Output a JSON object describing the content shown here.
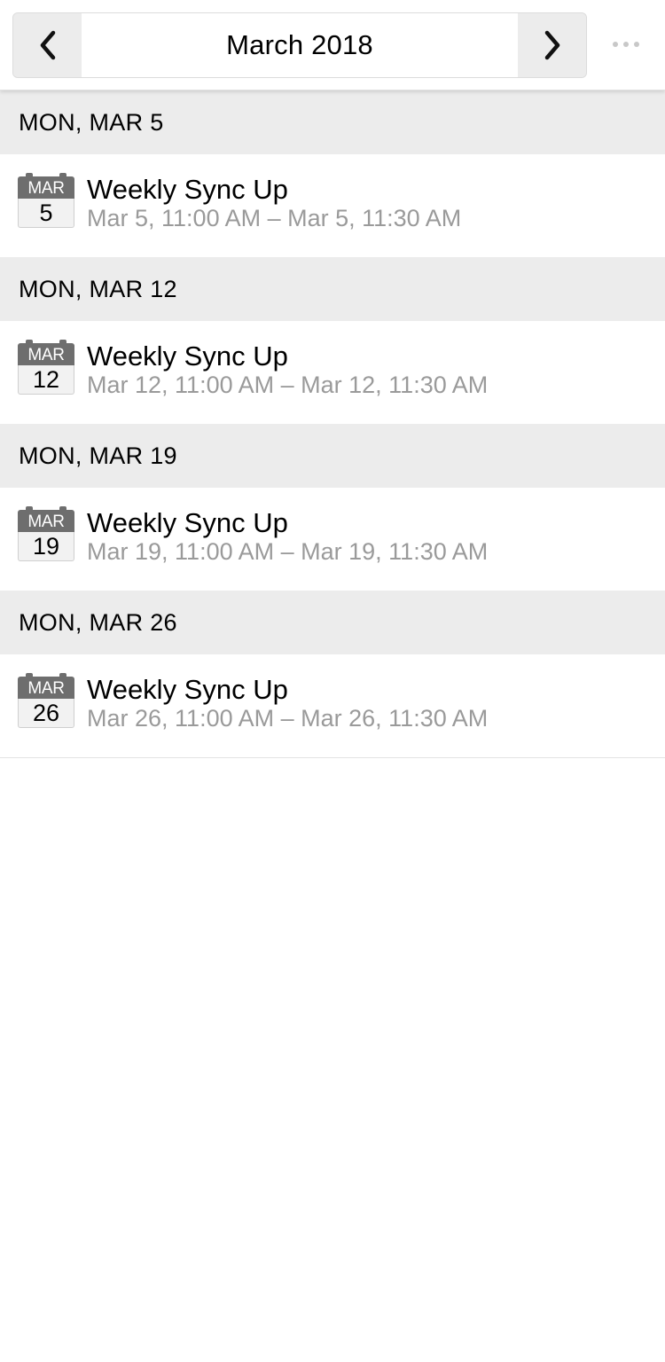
{
  "header": {
    "month_label": "March 2018",
    "prev_icon": "chevron-left-icon",
    "next_icon": "chevron-right-icon",
    "more_icon": "more-horizontal-icon"
  },
  "colors": {
    "day_header_bg": "#ececec",
    "icon_gray": "#6e6e6e",
    "secondary_text": "#9a9a9a"
  },
  "days": [
    {
      "header": "MON, MAR 5",
      "event": {
        "badge_month": "MAR",
        "badge_day": "5",
        "title": "Weekly Sync Up",
        "time": "Mar 5, 11:00 AM – Mar 5, 11:30 AM"
      }
    },
    {
      "header": "MON, MAR 12",
      "event": {
        "badge_month": "MAR",
        "badge_day": "12",
        "title": "Weekly Sync Up",
        "time": "Mar 12, 11:00 AM – Mar 12, 11:30 AM"
      }
    },
    {
      "header": "MON, MAR 19",
      "event": {
        "badge_month": "MAR",
        "badge_day": "19",
        "title": "Weekly Sync Up",
        "time": "Mar 19, 11:00 AM – Mar 19, 11:30 AM"
      }
    },
    {
      "header": "MON, MAR 26",
      "event": {
        "badge_month": "MAR",
        "badge_day": "26",
        "title": "Weekly Sync Up",
        "time": "Mar 26, 11:00 AM – Mar 26, 11:30 AM"
      }
    }
  ]
}
